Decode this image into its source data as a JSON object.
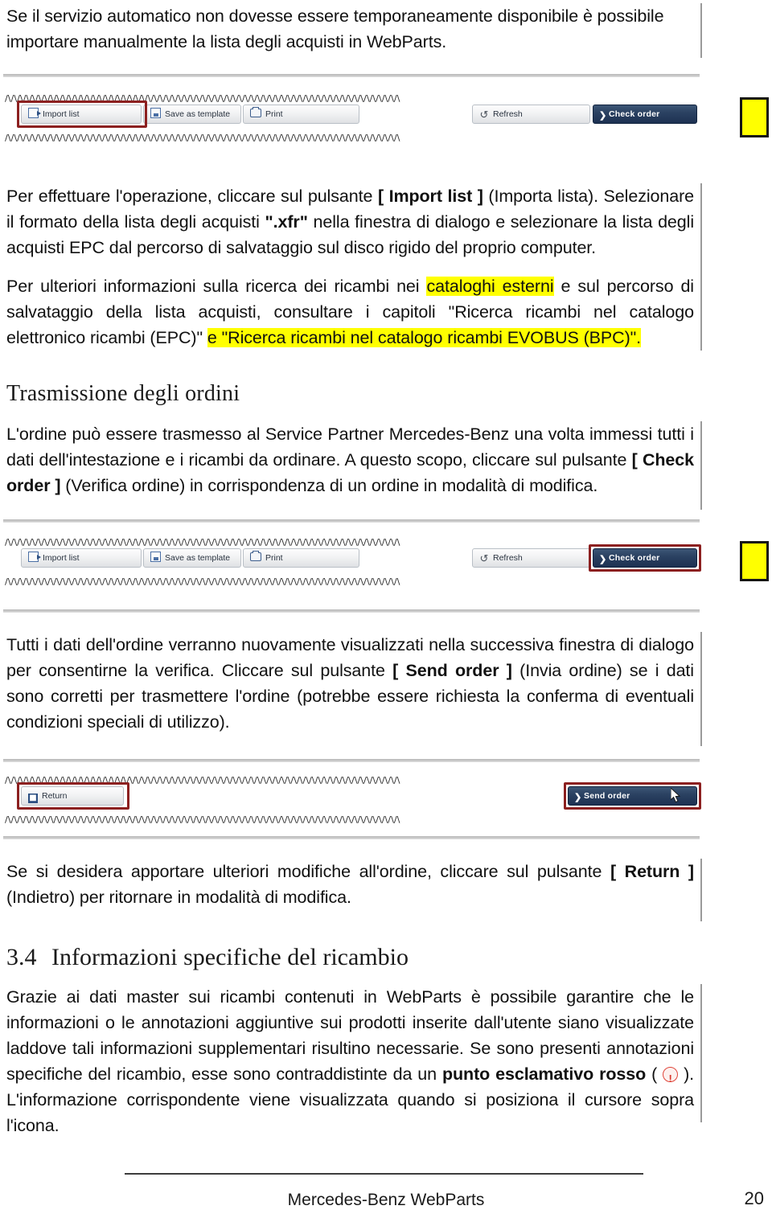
{
  "document": {
    "page_number": "20",
    "footer_title": "Mercedes-Benz WebParts"
  },
  "paragraphs": {
    "intro": {
      "line1": "Se il servizio automatico non dovesse essere temporaneamente disponibile è possibile",
      "line2": "importare manualmente la lista degli acquisti in WebParts."
    },
    "import_instructions": {
      "part1": "Per effettuare l'operazione, cliccare sul pulsante ",
      "bold1": "[ Import list ]",
      "part2": " (Importa lista). Selezionare il formato della lista degli acquisti ",
      "bold2": "\".xfr\"",
      "part3": " nella finestra di dialogo e selezionare la lista degli acquisti EPC dal percorso di salvataggio sul disco rigido del proprio computer."
    },
    "catalog_reference": {
      "part1": "Per ulteriori informazioni sulla ricerca dei ricambi nei ",
      "highlight1": "cataloghi esterni",
      "part2": " e sul percorso di salvataggio della lista acquisti, consultare i capitoli \"Ricerca ricambi nel catalogo elettronico ricambi (EPC)\" ",
      "highlight2": "e \"Ricerca ricambi nel catalogo ricambi EVOBUS (BPC)\".",
      "part3": ""
    },
    "transmission": {
      "part1": "L'ordine può essere trasmesso al Service Partner Mercedes-Benz una volta immessi tutti i dati dell'intestazione e i ricambi da ordinare. A questo scopo, cliccare sul pulsante ",
      "bold1": "[ Check order ]",
      "part2": " (Verifica ordine) in corrispondenza di un ordine in modalità di modifica."
    },
    "send_order": {
      "part1": "Tutti i dati dell'ordine verranno nuovamente visualizzati nella successiva finestra di dialogo per consentirne la verifica. Cliccare sul pulsante ",
      "bold1": "[ Send order ]",
      "part2": " (Invia ordine) se i dati sono corretti per trasmettere l'ordine (potrebbe essere richiesta la conferma di eventuali condizioni speciali di utilizzo)."
    },
    "return_note": {
      "part1": "Se si desidera apportare ulteriori modifiche all'ordine, cliccare sul pulsante ",
      "bold1": "[ Return ]",
      "part2": " (Indietro) per ritornare in modalità di modifica."
    },
    "part_info": {
      "part1": "Grazie ai dati master sui ricambi contenuti in WebParts è possibile garantire che le informazioni o le annotazioni aggiuntive sui prodotti inserite dall'utente siano visualizzate laddove tali informazioni supplementari risultino necessarie. Se sono presenti annotazioni specifiche del ricambio, esse sono contraddistinte da un ",
      "bold1": "punto esclamativo rosso",
      "part2": " ( ",
      "part3": " ). L'informazione corrispondente viene visualizzata quando si posiziona il cursore sopra l'icona."
    }
  },
  "headings": {
    "transmission": "Trasmissione degli ordini",
    "section_number": "3.4",
    "section_title": "Informazioni specifiche del ricambio"
  },
  "screenshots": {
    "toolbar_import": {
      "buttons": [
        {
          "label": "Import list",
          "icon": "import-list-icon",
          "style": "light",
          "highlighted": true
        },
        {
          "label": "Save as template",
          "icon": "save-template-icon",
          "style": "light",
          "highlighted": false
        },
        {
          "label": "Print",
          "icon": "print-icon",
          "style": "light",
          "highlighted": false
        },
        {
          "label": "Refresh",
          "icon": "refresh-icon",
          "style": "light",
          "highlighted": false
        },
        {
          "label": "Check order",
          "icon": "chevron-right-icon",
          "style": "dark",
          "highlighted": false
        }
      ]
    },
    "toolbar_check": {
      "buttons": [
        {
          "label": "Import list",
          "icon": "import-list-icon",
          "style": "light",
          "highlighted": false
        },
        {
          "label": "Save as template",
          "icon": "save-template-icon",
          "style": "light",
          "highlighted": false
        },
        {
          "label": "Print",
          "icon": "print-icon",
          "style": "light",
          "highlighted": false
        },
        {
          "label": "Refresh",
          "icon": "refresh-icon",
          "style": "light",
          "highlighted": false
        },
        {
          "label": "Check order",
          "icon": "chevron-right-icon",
          "style": "dark",
          "highlighted": true
        }
      ]
    },
    "toolbar_send": {
      "buttons": [
        {
          "label": "Return",
          "icon": "return-icon",
          "style": "light",
          "highlighted": true
        },
        {
          "label": "Send order",
          "icon": "chevron-right-icon",
          "style": "dark",
          "highlighted": true
        }
      ]
    }
  },
  "colors": {
    "highlight_yellow": "#ffff00",
    "callout_border": "#151515",
    "redbox": "#8c2020",
    "dark_button": "#1d3152",
    "exclamation_red": "#d8392c",
    "change_bar": "#9a9a9a"
  }
}
